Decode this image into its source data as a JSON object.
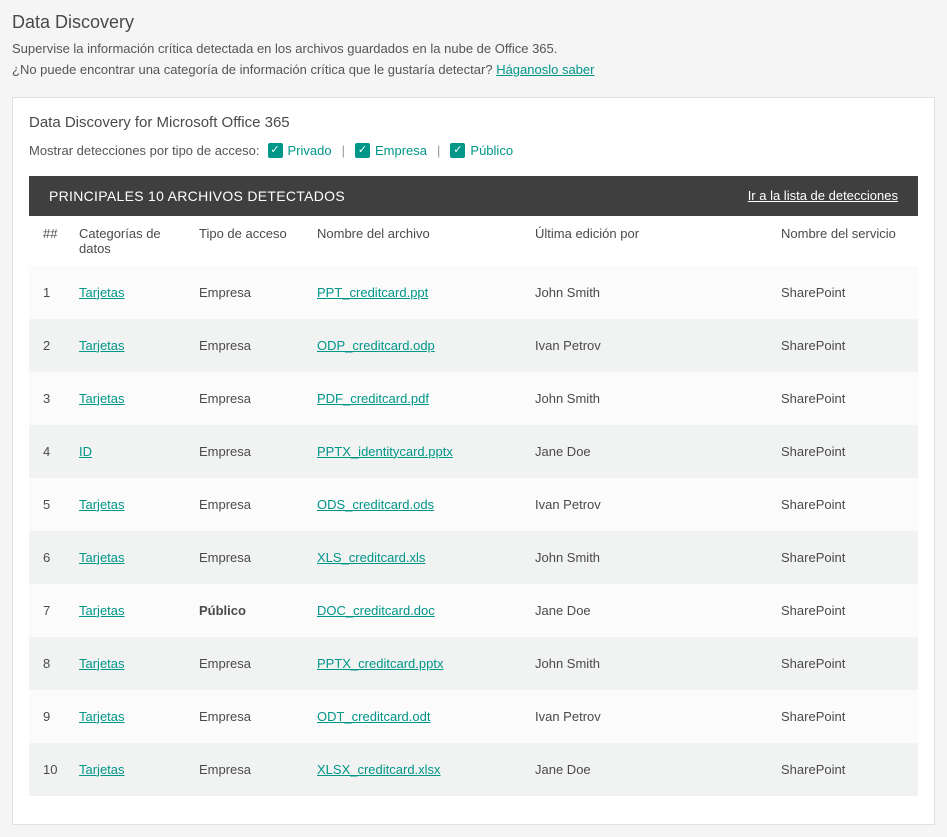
{
  "header": {
    "title": "Data Discovery",
    "subtitle": "Supervise la información crítica detectada en los archivos guardados en la nube de Office 365.",
    "question": "¿No puede encontrar una categoría de información crítica que le gustaría detectar? ",
    "feedback_link": "Háganoslo saber"
  },
  "panel": {
    "title": "Data Discovery for Microsoft Office 365",
    "filter_label": "Mostrar detecciones por tipo de acceso:",
    "filters": {
      "private": "Privado",
      "company": "Empresa",
      "public": "Público"
    }
  },
  "table": {
    "title": "PRINCIPALES 10 ARCHIVOS DETECTADOS",
    "goto_link": "Ir a la lista de detecciones",
    "columns": {
      "num": "##",
      "categories": "Categorías de datos",
      "access": "Tipo de acceso",
      "filename": "Nombre del archivo",
      "edited_by": "Última edición por",
      "service": "Nombre del servicio"
    },
    "rows": [
      {
        "num": "1",
        "category": "Tarjetas",
        "access": "Empresa",
        "access_bold": false,
        "filename": "PPT_creditcard.ppt",
        "edited_by": "John Smith",
        "service": "SharePoint"
      },
      {
        "num": "2",
        "category": "Tarjetas",
        "access": "Empresa",
        "access_bold": false,
        "filename": "ODP_creditcard.odp",
        "edited_by": "Ivan Petrov",
        "service": "SharePoint"
      },
      {
        "num": "3",
        "category": "Tarjetas",
        "access": "Empresa",
        "access_bold": false,
        "filename": "PDF_creditcard.pdf",
        "edited_by": "John Smith",
        "service": "SharePoint"
      },
      {
        "num": "4",
        "category": "ID",
        "access": "Empresa",
        "access_bold": false,
        "filename": "PPTX_identitycard.pptx",
        "edited_by": "Jane Doe",
        "service": "SharePoint"
      },
      {
        "num": "5",
        "category": "Tarjetas",
        "access": "Empresa",
        "access_bold": false,
        "filename": "ODS_creditcard.ods",
        "edited_by": "Ivan Petrov",
        "service": "SharePoint"
      },
      {
        "num": "6",
        "category": "Tarjetas",
        "access": "Empresa",
        "access_bold": false,
        "filename": "XLS_creditcard.xls",
        "edited_by": "John Smith",
        "service": "SharePoint"
      },
      {
        "num": "7",
        "category": "Tarjetas",
        "access": "Público",
        "access_bold": true,
        "filename": "DOC_creditcard.doc",
        "edited_by": "Jane Doe",
        "service": "SharePoint"
      },
      {
        "num": "8",
        "category": "Tarjetas",
        "access": "Empresa",
        "access_bold": false,
        "filename": "PPTX_creditcard.pptx",
        "edited_by": "John Smith",
        "service": "SharePoint"
      },
      {
        "num": "9",
        "category": "Tarjetas",
        "access": "Empresa",
        "access_bold": false,
        "filename": "ODT_creditcard.odt",
        "edited_by": "Ivan Petrov",
        "service": "SharePoint"
      },
      {
        "num": "10",
        "category": "Tarjetas",
        "access": "Empresa",
        "access_bold": false,
        "filename": "XLSX_creditcard.xlsx",
        "edited_by": "Jane Doe",
        "service": "SharePoint"
      }
    ]
  }
}
